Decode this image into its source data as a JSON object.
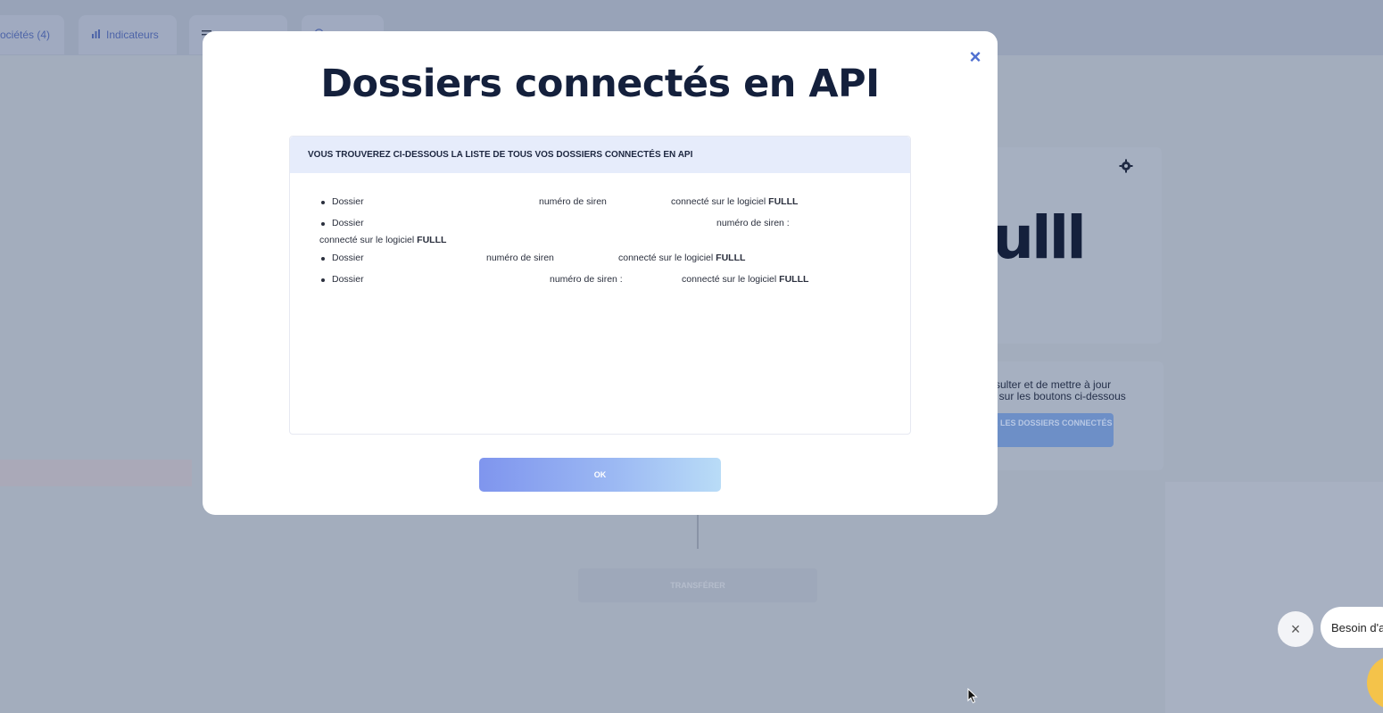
{
  "background": {
    "tabs": [
      {
        "label": "ociétés (4)",
        "icon": ""
      },
      {
        "label": "Indicateurs",
        "icon": "bar-chart-icon"
      },
      {
        "label": "",
        "icon": "sliders-icon"
      },
      {
        "label": "",
        "icon": "help-icon"
      }
    ],
    "logo_text": "ulll",
    "panel_text_line1": "sulter et de mettre à jour",
    "panel_text_line2": "t sur les boutons ci-dessous",
    "view_folders_button": "VOIR LES DOSSIERS CONNECTÉS",
    "lower_button": "TRANSFÉRER"
  },
  "modal": {
    "title": "Dossiers connectés en API",
    "close_glyph": "×",
    "list_header": "VOUS TROUVEREZ CI-DESSOUS LA LISTE DE TOUS VOS DOSSIERS CONNECTÉS EN API",
    "rows": [
      {
        "dossier": "Dossier",
        "siren": "numéro de siren",
        "connected": "connecté sur le logiciel",
        "software": "FULLL"
      },
      {
        "dossier": "Dossier",
        "siren": "numéro de siren :",
        "connected": "connecté sur le logiciel",
        "software": "FULLL"
      },
      {
        "dossier": "Dossier",
        "siren": "numéro de siren",
        "connected": "connecté sur le logiciel",
        "software": "FULLL"
      },
      {
        "dossier": "Dossier",
        "siren": "numéro de siren :",
        "connected": "connecté sur le logiciel",
        "software": "FULLL"
      }
    ],
    "ok_button": "OK"
  },
  "chat": {
    "close_glyph": "×",
    "bubble_text": "Besoin d'a"
  }
}
